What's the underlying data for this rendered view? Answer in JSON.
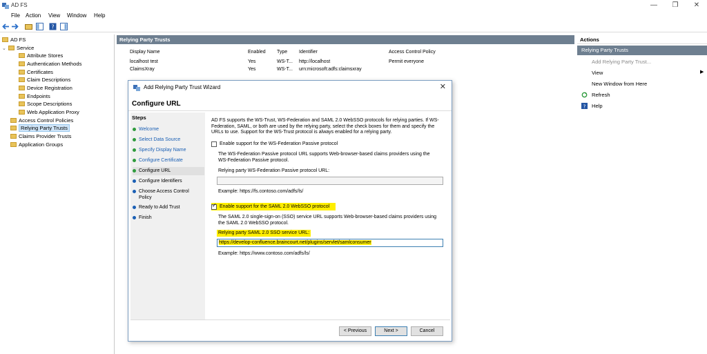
{
  "window": {
    "title": "AD FS",
    "minimize": "—",
    "restore": "❐",
    "close": "✕"
  },
  "menu": [
    "File",
    "Action",
    "View",
    "Window",
    "Help"
  ],
  "tree": {
    "root": "AD FS",
    "items": [
      {
        "label": "Service"
      },
      {
        "label": "Attribute Stores"
      },
      {
        "label": "Authentication Methods"
      },
      {
        "label": "Certificates"
      },
      {
        "label": "Claim Descriptions"
      },
      {
        "label": "Device Registration"
      },
      {
        "label": "Endpoints"
      },
      {
        "label": "Scope Descriptions"
      },
      {
        "label": "Web Application Proxy"
      },
      {
        "label": "Access Control Policies"
      },
      {
        "label": "Relying Party Trusts"
      },
      {
        "label": "Claims Provider Trusts"
      },
      {
        "label": "Application Groups"
      }
    ]
  },
  "center": {
    "title": "Relying Party Trusts",
    "columns": [
      "Display Name",
      "Enabled",
      "Type",
      "Identifier",
      "Access Control Policy"
    ],
    "rows": [
      [
        "localhost test",
        "Yes",
        "WS-T...",
        "http://localhost",
        "Permit everyone"
      ],
      [
        "ClaimsXray",
        "Yes",
        "WS-T...",
        "urn:microsoft:adfs:claimsxray",
        ""
      ]
    ]
  },
  "actions": {
    "header": "Actions",
    "section": "Relying Party Trusts",
    "items": [
      "Add Relying Party Trust...",
      "View",
      "New Window from Here",
      "Refresh",
      "Help"
    ]
  },
  "dialog": {
    "title": "Add Relying Party Trust Wizard",
    "heading": "Configure URL",
    "steps_header": "Steps",
    "steps": [
      "Welcome",
      "Select Data Source",
      "Specify Display Name",
      "Configure Certificate",
      "Configure URL",
      "Configure Identifiers",
      "Choose Access Control Policy",
      "Ready to Add Trust",
      "Finish"
    ],
    "intro": "AD FS supports the WS-Trust, WS-Federation and SAML 2.0 WebSSO protocols for relying parties.  If WS-Federation, SAML, or both are used by the relying party, select the check boxes for them and specify the URLs to use.  Support for the WS-Trust protocol is always enabled for a relying party.",
    "wsfed_checkbox": "Enable support for the WS-Federation Passive protocol",
    "wsfed_desc": "The WS-Federation Passive protocol URL supports Web-browser-based claims providers using the WS-Federation Passive protocol.",
    "wsfed_url_label": "Relying party WS-Federation Passive protocol URL:",
    "wsfed_url_value": "",
    "wsfed_example": "Example: https://fs.contoso.com/adfs/ls/",
    "saml_checkbox": "Enable support for the SAML 2.0 WebSSO protocol",
    "saml_desc": "The SAML 2.0 single-sign-on (SSO) service URL supports Web-browser-based claims providers using the SAML 2.0 WebSSO protocol.",
    "saml_url_label": "Relying party SAML 2.0 SSO service URL:",
    "saml_url_value": "https://develop-confluence.braincourt.net/plugins/servlet/samlconsumer",
    "saml_example": "Example: https://www.contoso.com/adfs/ls/",
    "buttons": {
      "previous": "< Previous",
      "next": "Next >",
      "cancel": "Cancel"
    }
  },
  "colors": {
    "header_bg": "#6e7f90",
    "highlight": "#ffee00",
    "link": "#1a5fb4",
    "step_done": "#2e9b3c",
    "step_todo": "#1a5fb4"
  }
}
